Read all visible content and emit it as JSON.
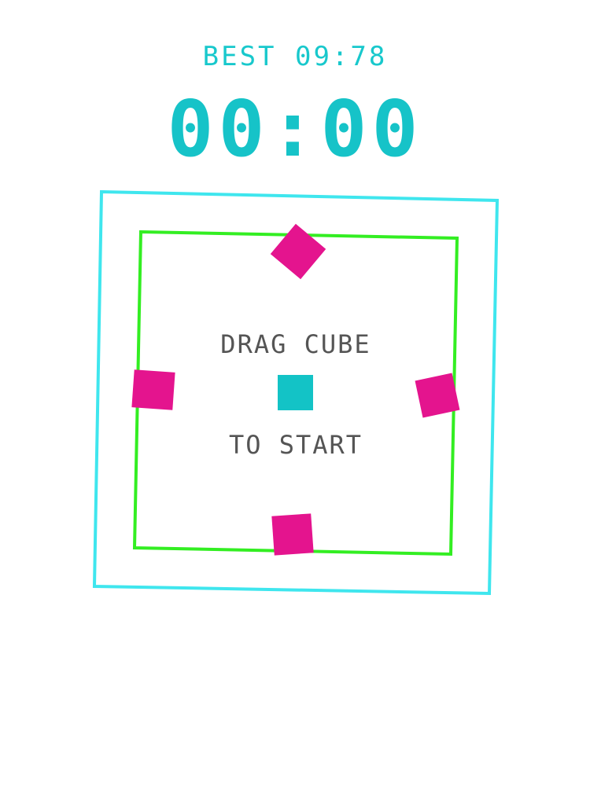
{
  "hud": {
    "best_label": "BEST 09:78",
    "timer": "00:00"
  },
  "playfield": {
    "prompt_line1": "DRAG CUBE",
    "prompt_line2": "TO START"
  },
  "colors": {
    "outer_border": "#3fe6ee",
    "inner_border": "#33ee22",
    "enemy": "#e4148e",
    "player": "#13c3c6",
    "timer": "#16c3c8"
  },
  "icons": {
    "player": "cyan-square-cube",
    "enemy": "magenta-square-block"
  }
}
